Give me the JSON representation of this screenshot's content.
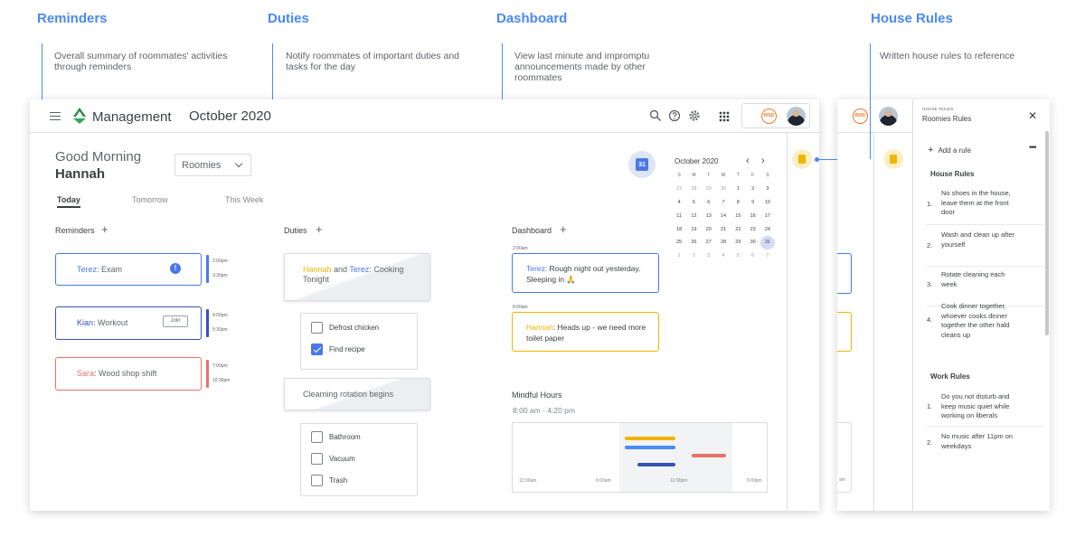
{
  "annotations": [
    {
      "title": "Reminders",
      "desc": "Overall summary of roommates' activities through reminders"
    },
    {
      "title": "Duties",
      "desc": "Notify roommates of important duties and tasks for the day"
    },
    {
      "title": "Dashboard",
      "desc": "View last minute and impromptu announcements made by other roommates"
    },
    {
      "title": "House Rules",
      "desc": "Written house rules to reference"
    }
  ],
  "header": {
    "app_title": "Management",
    "month": "October 2020",
    "risd_logo": "RISD"
  },
  "greeting": {
    "line1": "Good Morning",
    "name": "Hannah"
  },
  "group_select": {
    "value": "Roomies"
  },
  "tabs": [
    "Today",
    "Tomorrow",
    "This Week"
  ],
  "reminders": {
    "label": "Reminders",
    "items": [
      {
        "who": "Terez",
        "what": ": Exam",
        "times": [
          "2:00pm",
          "3:30pm"
        ],
        "color": "#4a78e8"
      },
      {
        "who": "Kian",
        "what": ": Workout",
        "times": [
          "4:00pm",
          "5:30pm"
        ],
        "color": "#3a51b5",
        "action": "Join"
      },
      {
        "who": "Sara",
        "what": ": Wood shop shift",
        "times": [
          "7:00pm",
          "10:30pm"
        ],
        "color": "#e57368"
      }
    ]
  },
  "duties": {
    "label": "Duties",
    "card1": {
      "a": "Hannah",
      "and": " and ",
      "b": "Terez",
      "rest": ": Cooking Tonight"
    },
    "list1": [
      {
        "label": "Defrost chicken",
        "checked": false
      },
      {
        "label": "Find recipe",
        "checked": true
      }
    ],
    "card2": "Clearning rotation begins",
    "list2": [
      {
        "label": "Bathroom",
        "checked": false
      },
      {
        "label": "Vacuum",
        "checked": false
      },
      {
        "label": "Trash",
        "checked": false
      }
    ]
  },
  "dashboard": {
    "label": "Dashboard",
    "posts": [
      {
        "time": "2:00am",
        "who": "Terez",
        "text": ": Rough night out yesterday. Sleeping in 🙏",
        "color": "#4a78e8"
      },
      {
        "time": "8:00am",
        "who": "Hannah",
        "text": ": Heads up - we need more toilet paper",
        "color": "#f2b300"
      }
    ],
    "mindful": {
      "title": "Mindful Hours",
      "range": "8:00 am - 4:20 pm",
      "ticks": [
        "12:00am",
        "6:00am",
        "12:00pm",
        "6:00pm"
      ],
      "bar_colors": [
        "#f2b300",
        "#4a89f3",
        "#e57368",
        "#3a51b5"
      ]
    }
  },
  "calendar": {
    "title": "October 2020",
    "icon_day": "31",
    "weekdays": [
      "S",
      "M",
      "T",
      "W",
      "T",
      "F",
      "S"
    ],
    "days": [
      "27",
      "28",
      "29",
      "30",
      "1",
      "2",
      "3",
      "4",
      "5",
      "6",
      "7",
      "8",
      "9",
      "10",
      "11",
      "12",
      "13",
      "14",
      "15",
      "16",
      "17",
      "18",
      "19",
      "20",
      "21",
      "22",
      "23",
      "24",
      "25",
      "26",
      "27",
      "28",
      "29",
      "30",
      "31",
      "1",
      "2",
      "3",
      "4",
      "5",
      "6",
      "7"
    ]
  },
  "rules_panel": {
    "kicker": "HOUSE RULES",
    "title": "Roomies Rules",
    "add_label": "Add a rule",
    "house_label": "House Rules",
    "house": [
      "No shoes in the house, leave them at the front door",
      "Wash and clean up after yourself",
      "Rotate cleaning each week",
      "Cook dinner together, whoever cooks dinner together the other hald cleans up"
    ],
    "work_label": "Work Rules",
    "work": [
      "Do you not disturb and keep music quiet while working on liberals",
      "No music after 11pm on weekdays"
    ],
    "peek_tick": "am"
  }
}
